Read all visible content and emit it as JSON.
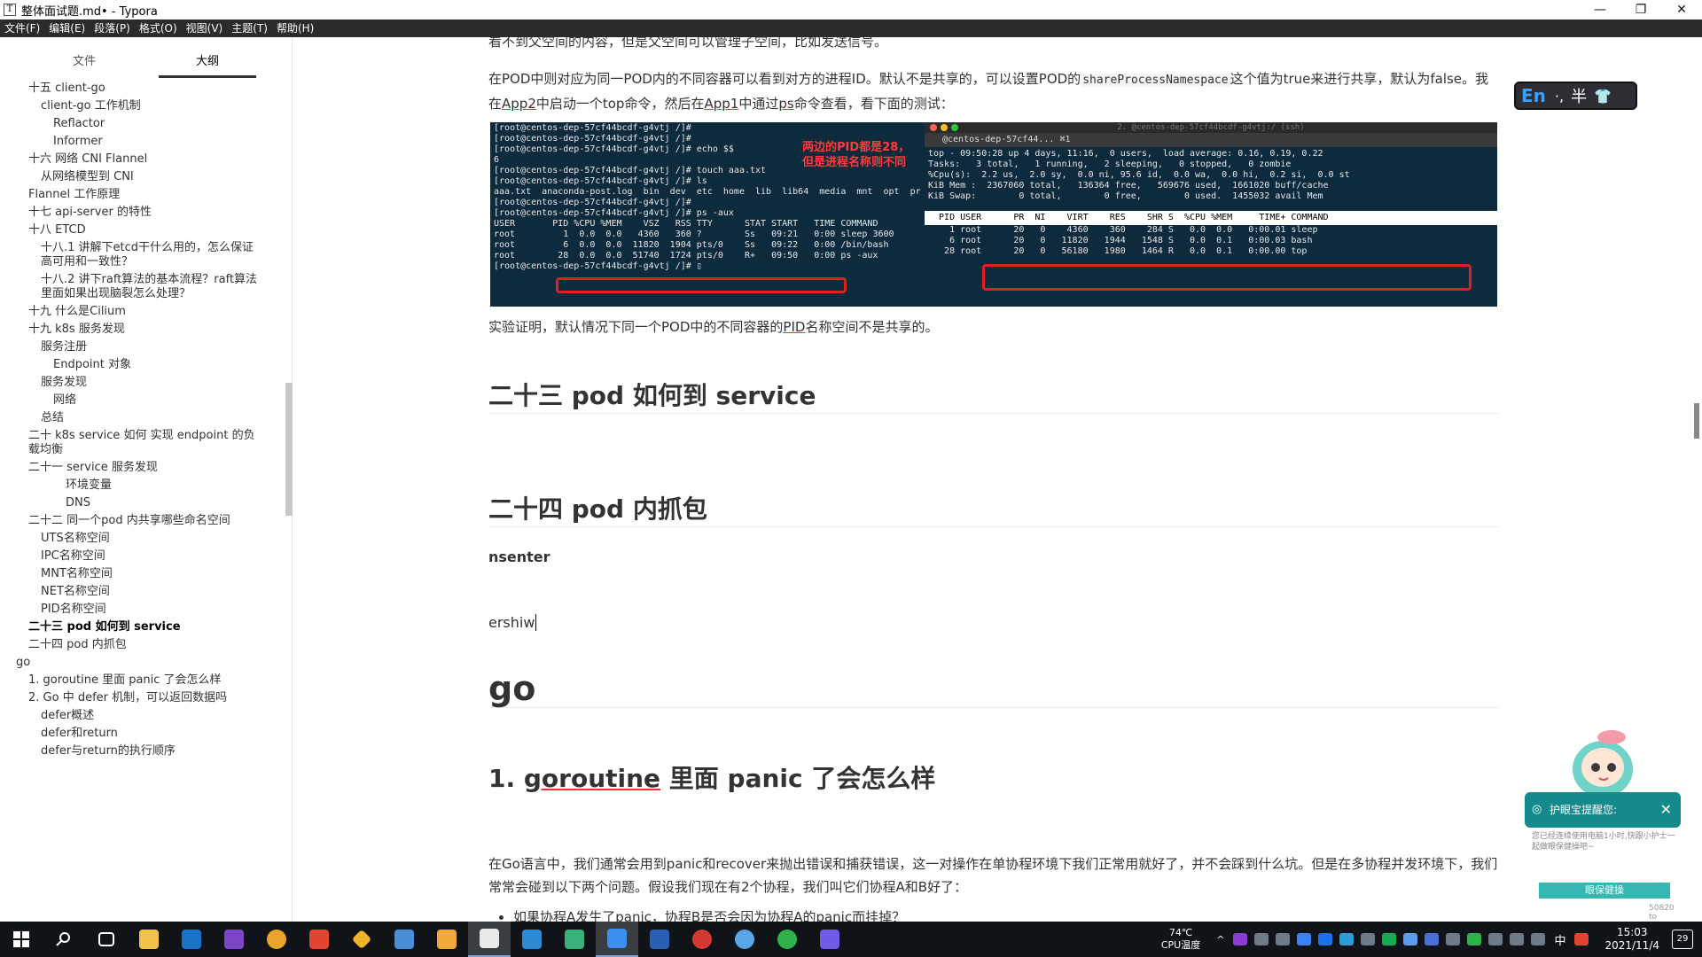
{
  "titlebar": {
    "title": "整体面试题.md• - Typora",
    "app_icon": "T",
    "minimize": "—",
    "restore": "❐",
    "close": "✕"
  },
  "menubar": [
    "文件(F)",
    "编辑(E)",
    "段落(P)",
    "格式(O)",
    "视图(V)",
    "主题(T)",
    "帮助(H)"
  ],
  "sidebar": {
    "tabs": [
      "文件",
      "大纲"
    ],
    "active_tab": "大纲",
    "outline": [
      {
        "label": "十五 client-go",
        "level": 1
      },
      {
        "label": "client-go 工作机制",
        "level": 2
      },
      {
        "label": "Reflactor",
        "level": 3
      },
      {
        "label": "Informer",
        "level": 3
      },
      {
        "label": "十六 网络 CNI Flannel",
        "level": 1
      },
      {
        "label": "从网络模型到 CNI",
        "level": 2
      },
      {
        "label": "Flannel 工作原理",
        "level": 1
      },
      {
        "label": "十七 api-server 的特性",
        "level": 1
      },
      {
        "label": "十八 ETCD",
        "level": 1
      },
      {
        "label": "十八.1 讲解下etcd干什么用的，怎么保证高可用和一致性？",
        "level": 2
      },
      {
        "label": "十八.2 讲下raft算法的基本流程？raft算法里面如果出现脑裂怎么处理？",
        "level": 2
      },
      {
        "label": "十九 什么是Cilium",
        "level": 1
      },
      {
        "label": "十九 k8s 服务发现",
        "level": 1
      },
      {
        "label": "服务注册",
        "level": 2
      },
      {
        "label": "Endpoint 对象",
        "level": 3
      },
      {
        "label": "服务发现",
        "level": 2
      },
      {
        "label": "网络",
        "level": 3
      },
      {
        "label": "总结",
        "level": 2
      },
      {
        "label": "二十 k8s service 如何 实现 endpoint 的负载均衡",
        "level": 1
      },
      {
        "label": "二十一 service 服务发现",
        "level": 1
      },
      {
        "label": "环境变量",
        "level": 4
      },
      {
        "label": "DNS",
        "level": 4
      },
      {
        "label": "二十二 同一个pod 内共享哪些命名空间",
        "level": 1
      },
      {
        "label": "UTS名称空间",
        "level": 2
      },
      {
        "label": "IPC名称空间",
        "level": 2
      },
      {
        "label": "MNT名称空间",
        "level": 2
      },
      {
        "label": "NET名称空间",
        "level": 2
      },
      {
        "label": "PID名称空间",
        "level": 2
      },
      {
        "label": "二十三 pod 如何到 service",
        "level": 1,
        "active": true
      },
      {
        "label": "二十四 pod 内抓包",
        "level": 1
      },
      {
        "label": "go",
        "level": 0
      },
      {
        "label": "1. goroutine 里面 panic 了会怎么样",
        "level": 1
      },
      {
        "label": "2. Go 中 defer 机制，可以返回数据吗",
        "level": 1
      },
      {
        "label": "defer概述",
        "level": 2
      },
      {
        "label": "defer和return",
        "level": 2
      },
      {
        "label": "defer与return的执行顺序",
        "level": 2
      }
    ],
    "footer": {
      "back": "‹",
      "source": "</>"
    }
  },
  "editor": {
    "top_line": "看不到父空间的内容，但是父空间可以管理子空间，比如发送信号。",
    "para1_a": "在POD中则对应为同一POD内的不同容器可以看到对方的进程ID。默认不是共享的，可以设置POD的",
    "para1_code": "shareProcessNamespace",
    "para1_b": "这个值为true来进行共享，默认为false。我在",
    "para1_app2": "App2",
    "para1_c": "中启动一个top命令，然后在",
    "para1_app1": "App1",
    "para1_d": "中通过",
    "para1_ps": "ps",
    "para1_e": "命令查看，看下面的测试：",
    "conclusion_a": "实验证明，默认情况下同一个POD中的不同容器的",
    "conclusion_pid": "PID",
    "conclusion_b": "名称空间不是共享的。",
    "h_23": "二十三 pod  如何到 service",
    "h_24": "二十四 pod 内抓包",
    "nsenter": "nsenter",
    "typing": "ershiw",
    "h_go": "go",
    "h_goroutine_a": "1. ",
    "h_goroutine_b": "goroutine",
    "h_goroutine_c": " 里面 panic 了会怎么样",
    "go_para": "在Go语言中，我们通常会用到panic和recover来抛出错误和捕获错误，这一对操作在单协程环境下我们正常用就好了，并不会踩到什么坑。但是在多协程并发环境下，我们常常会碰到以下两个问题。假设我们现在有2个协程，我们叫它们协程A和B好了：",
    "bullet": "如果协程A发生了panic，协程B是否会因为协程A的panic而挂掉？"
  },
  "terminal": {
    "left_lines": "[root@centos-dep-57cf44bcdf-g4vtj /]#\n[root@centos-dep-57cf44bcdf-g4vtj /]#\n[root@centos-dep-57cf44bcdf-g4vtj /]# echo $$\n6\n[root@centos-dep-57cf44bcdf-g4vtj /]# touch aaa.txt\n[root@centos-dep-57cf44bcdf-g4vtj /]# ls\naaa.txt  anaconda-post.log  bin  dev  etc  home  lib  lib64  media  mnt  opt  pr\n[root@centos-dep-57cf44bcdf-g4vtj /]#\n[root@centos-dep-57cf44bcdf-g4vtj /]# ps -aux\nUSER       PID %CPU %MEM    VSZ   RSS TTY      STAT START   TIME COMMAND\nroot         1  0.0  0.0   4360   360 ?        Ss   09:21   0:00 sleep 3600\nroot         6  0.0  0.0  11820  1904 pts/0    Ss   09:22   0:00 /bin/bash\nroot        28  0.0  0.0  51740  1724 pts/0    R+   09:50   0:00 ps -aux\n[root@centos-dep-57cf44bcdf-g4vtj /]# ▯",
    "annotation": "两边的PID都是28，但是进程名称则不同",
    "right_title": "2. @centos-dep-57cf44bcdf-g4vtj:/ (ssh)",
    "right_tab": "@centos-dep-57cf44...  ⌘1",
    "right_top": "top - 09:50:28 up 4 days, 11:16,  0 users,  load average: 0.16, 0.19, 0.22\nTasks:   3 total,   1 running,   2 sleeping,   0 stopped,   0 zombie\n%Cpu(s):  2.2 us,  2.0 sy,  0.0 ni, 95.6 id,  0.0 wa,  0.0 hi,  0.2 si,  0.0 st\nKiB Mem :  2367060 total,   136364 free,   569676 used,  1661020 buff/cache\nKiB Swap:        0 total,        0 free,        0 used.  1455032 avail Mem",
    "right_header": "  PID USER      PR  NI    VIRT    RES    SHR S  %CPU %MEM     TIME+ COMMAND",
    "right_rows": "    1 root      20   0    4360    360    284 S   0.0  0.0   0:00.01 sleep\n    6 root      20   0   11820   1944   1548 S   0.0  0.1   0:00.03 bash\n   28 root      20   0   56180   1980   1464 R   0.0  0.1   0:00.00 top"
  },
  "ime": {
    "mode": "En",
    "punct": "·,",
    "width": "半",
    "skin": "👕"
  },
  "eyecare": {
    "title": "护眼宝提醒您:",
    "close": "✕",
    "message": "您已经连续使用电脑1小时,快跟小护士一起做眼保健操吧~",
    "button": "眼保健操",
    "counter": "50820 to"
  },
  "taskbar": {
    "temp": "74℃",
    "temp_label": "CPU温度",
    "time": "15:03",
    "date": "2021/11/4",
    "ime_tray": "中",
    "notifications": "29"
  }
}
